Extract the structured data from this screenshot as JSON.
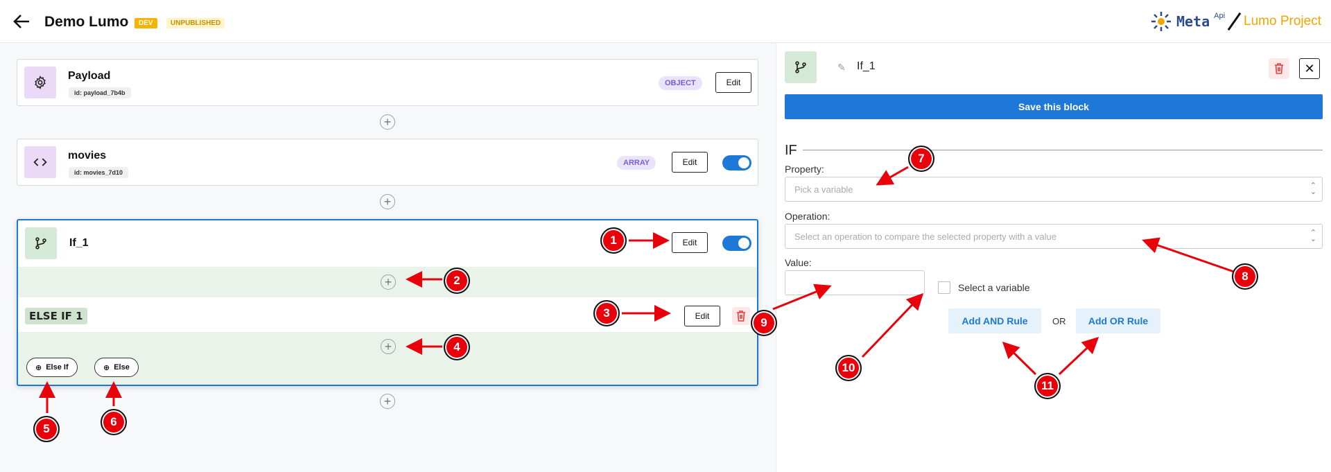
{
  "header": {
    "title": "Demo Lumo",
    "env_badge": "DEV",
    "status_badge": "UNPUBLISHED",
    "brand_meta": "Meta",
    "brand_api": "Api",
    "brand_project": "Lumo Project"
  },
  "blocks": [
    {
      "name": "Payload",
      "id": "id: payload_7b4b",
      "type": "OBJECT",
      "edit": "Edit",
      "icon": "gear-icon"
    },
    {
      "name": "movies",
      "id": "id: movies_7d10",
      "type": "ARRAY",
      "edit": "Edit",
      "icon": "code-icon"
    }
  ],
  "if_block": {
    "name": "If_1",
    "edit": "Edit",
    "else_if_label": "ELSE IF 1",
    "else_if_edit": "Edit",
    "add_else_if": "Else If",
    "add_else": "Else"
  },
  "panel": {
    "block_name": "If_1",
    "save": "Save this block",
    "section": "IF",
    "property_label": "Property:",
    "property_placeholder": "Pick a variable",
    "operation_label": "Operation:",
    "operation_placeholder": "Select an operation to compare the selected property with a value",
    "value_label": "Value:",
    "select_variable": "Select a variable",
    "add_and": "Add AND Rule",
    "or": "OR",
    "add_or": "Add OR Rule"
  },
  "markers": [
    "1",
    "2",
    "3",
    "4",
    "5",
    "6",
    "7",
    "8",
    "9",
    "10",
    "11"
  ],
  "colors": {
    "accent": "#1e78d7",
    "marker": "#e8000b",
    "dev": "#f5b400",
    "brand_project": "#f0a500"
  }
}
